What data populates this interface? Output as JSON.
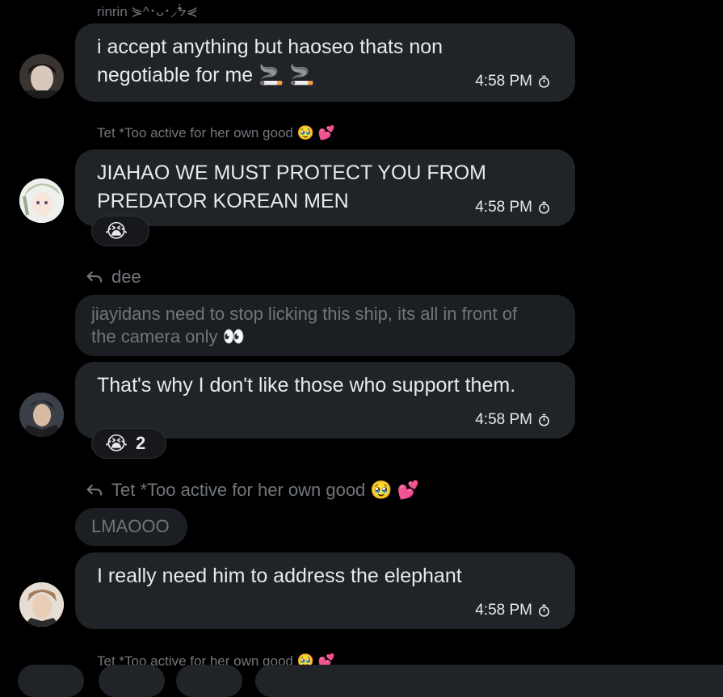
{
  "messages": [
    {
      "sender": "rinrin ⋟^･ᴗ･⸝ᖭ⋞",
      "text_lines": [
        "i accept anything but haoseo thats non",
        "negotiable for me 🚬 🚬"
      ],
      "time": "4:58 PM",
      "avatar": "avatar-person-dark-hair"
    },
    {
      "sender": "Tet *Too active for her own good 🥹 💕",
      "text_lines": [
        "JIAHAO WE MUST PROTECT YOU FROM",
        "PREDATOR KOREAN MEN"
      ],
      "time": "4:58 PM",
      "reaction": {
        "emoji": "😭",
        "count": ""
      },
      "avatar": "avatar-anime-character"
    },
    {
      "reply_to": "dee",
      "quoted": [
        "jiayidans need to stop licking this ship, its all in front of",
        "the camera only 👀"
      ],
      "text_lines": [
        "That's why I don't like those who support them."
      ],
      "time": "4:58 PM",
      "reaction": {
        "emoji": "😭",
        "count": "2"
      },
      "avatar": "avatar-person-jacket"
    },
    {
      "reply_to": "Tet *Too active for her own good 🥹 💕",
      "quoted": [
        "LMAOOO"
      ],
      "text_lines": [
        "I really need him to address the elephant"
      ],
      "time": "4:58 PM",
      "avatar": "avatar-person-blond"
    },
    {
      "sender": "Tet *Too active for her own good 🥹 💕"
    }
  ],
  "icons": {
    "timer": "disappearing-timer-icon",
    "reply": "reply-arrow-icon"
  },
  "colors": {
    "background": "#000000",
    "bubble": "#202327",
    "muted_text": "#71767b",
    "text": "#e7e9ea"
  }
}
